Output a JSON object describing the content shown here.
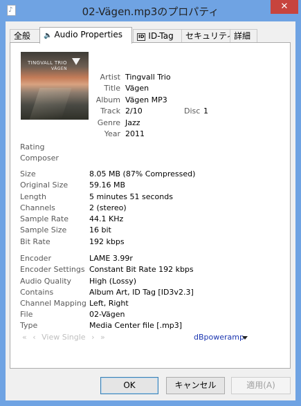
{
  "window": {
    "title": "02-Vägen.mp3のプロパティ",
    "close_label": "✕"
  },
  "tabs": [
    {
      "label": "全般"
    },
    {
      "label": "Audio Properties",
      "icon": "speaker-icon"
    },
    {
      "label": "ID-Tag",
      "icon": "id-tag-icon"
    },
    {
      "label": "セキュリティ"
    },
    {
      "label": "詳細"
    }
  ],
  "album_art": {
    "brand": "TINGVALL TRIO",
    "album": "VÄGEN"
  },
  "tags": {
    "artist_label": "Artist",
    "artist": "Tingvall Trio",
    "title_label": "Title",
    "title": "Vägen",
    "album_label": "Album",
    "album": "Vägen MP3",
    "track_label": "Track",
    "track": "2/10",
    "disc_label": "Disc",
    "disc": "1",
    "genre_label": "Genre",
    "genre": "Jazz",
    "year_label": "Year",
    "year": "2011",
    "rating_label": "Rating",
    "composer_label": "Composer"
  },
  "audio": [
    {
      "label": "Size",
      "value": "8.05 MB  (87% Compressed)"
    },
    {
      "label": "Original Size",
      "value": "59.16 MB"
    },
    {
      "label": "Length",
      "value": "5 minutes 51 seconds"
    },
    {
      "label": "Channels",
      "value": "2  (stereo)"
    },
    {
      "label": "Sample Rate",
      "value": "44.1 KHz"
    },
    {
      "label": "Sample Size",
      "value": "16 bit"
    },
    {
      "label": "Bit Rate",
      "value": "192 kbps"
    }
  ],
  "encoder": [
    {
      "label": "Encoder",
      "value": "LAME 3.99r"
    },
    {
      "label": "Encoder Settings",
      "value": "Constant Bit Rate 192 kbps"
    },
    {
      "label": "Audio Quality",
      "value": "High  (Lossy)"
    },
    {
      "label": "Contains",
      "value": "Album Art, ID Tag [ID3v2.3]"
    },
    {
      "label": "Channel Mapping",
      "value": "Left, Right"
    },
    {
      "label": "File",
      "value": "02-Vägen"
    },
    {
      "label": "Type",
      "value": "Media Center file    [.mp3]"
    }
  ],
  "nav": {
    "first": "«",
    "prev": "‹",
    "view_single": "View Single",
    "next": "›",
    "last": "»"
  },
  "dbpoweramp_label": "dBpoweramp",
  "buttons": {
    "ok": "OK",
    "cancel": "キャンセル",
    "apply": "適用(A)"
  }
}
